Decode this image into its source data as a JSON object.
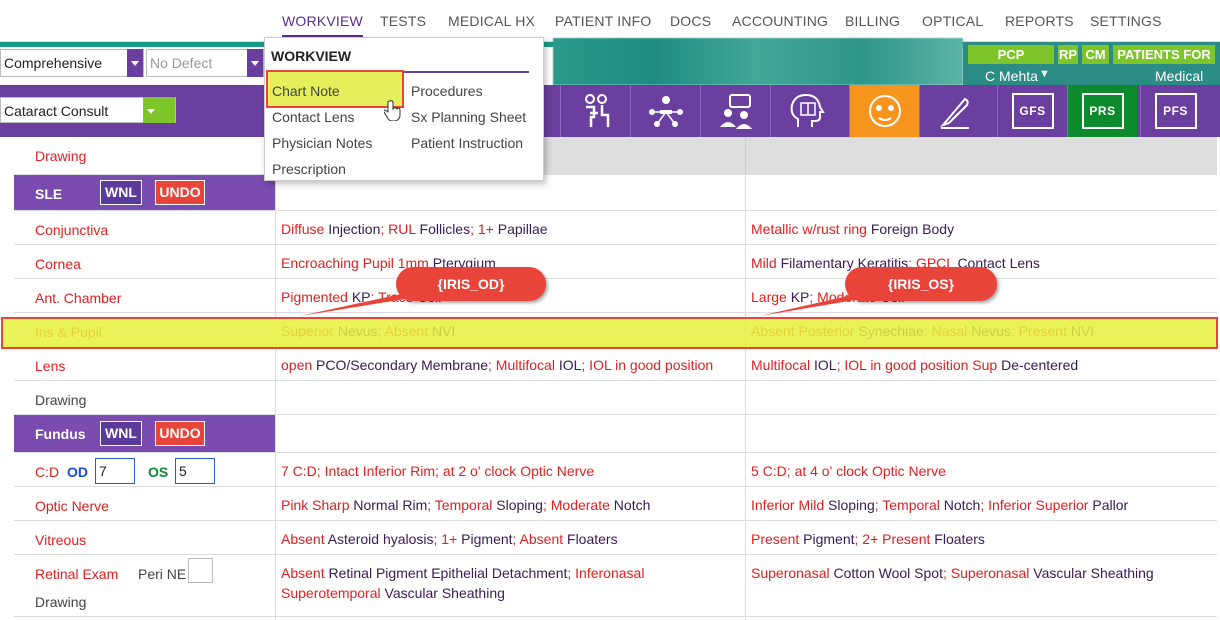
{
  "nav": {
    "items": [
      "WORKVIEW",
      "TESTS",
      "MEDICAL HX",
      "PATIENT INFO",
      "DOCS",
      "ACCOUNTING",
      "BILLING",
      "OPTICAL",
      "REPORTS",
      "SETTINGS"
    ],
    "active": "WORKVIEW"
  },
  "toolbar": {
    "exam_type": "Comprehensive",
    "defect_placeholder": "No Defect",
    "visit_template": "Cataract Consult"
  },
  "right_panel": {
    "pcp_label": "PCP",
    "rp_label": "RP",
    "cm_label": "CM",
    "patients_forms_label": "PATIENTS FOR",
    "provider_name": "C Mehta",
    "category": "Medical"
  },
  "icon_bar": {
    "tags": [
      "GFS",
      "PRS",
      "PFS"
    ],
    "icons": [
      "patient-exam-icon",
      "network-icon",
      "consult-icon",
      "head-book-icon",
      "face-icon",
      "scalpel-icon"
    ]
  },
  "workview_menu": {
    "title": "WORKVIEW",
    "col1": [
      "Chart Note",
      "Contact Lens",
      "Physician Notes",
      "Prescription"
    ],
    "col2": [
      "Procedures",
      "Sx Planning Sheet",
      "Patient Instruction"
    ]
  },
  "exam": {
    "drawing_label": "Drawing",
    "sle": {
      "title": "SLE",
      "wnl_label": "WNL",
      "undo_label": "UNDO",
      "rows": [
        {
          "label": "Conjunctiva",
          "od": [
            [
              "r",
              "Diffuse "
            ],
            [
              "k",
              "Injection"
            ],
            [
              "r",
              "; RUL "
            ],
            [
              "k",
              "Follicles"
            ],
            [
              "r",
              "; 1+ "
            ],
            [
              "k",
              "Papillae"
            ]
          ],
          "os": [
            [
              "r",
              "Metallic w/rust ring "
            ],
            [
              "k",
              "Foreign Body"
            ]
          ]
        },
        {
          "label": "Cornea",
          "od": [
            [
              "r",
              "Encroaching Pupil 1mm "
            ],
            [
              "k",
              "Pterygium"
            ]
          ],
          "os": [
            [
              "r",
              "Mild "
            ],
            [
              "k",
              "Filamentary Keratitis"
            ],
            [
              "r",
              "; GPCL "
            ],
            [
              "k",
              "Contact Lens"
            ]
          ]
        },
        {
          "label": "Ant. Chamber",
          "od": [
            [
              "r",
              "Pigmented "
            ],
            [
              "k",
              "KP"
            ],
            [
              "r",
              "; Trace "
            ],
            [
              "k",
              "Cell"
            ]
          ],
          "os": [
            [
              "r",
              "Large "
            ],
            [
              "k",
              "KP"
            ],
            [
              "r",
              "; Moderate "
            ],
            [
              "k",
              "Cell"
            ]
          ]
        },
        {
          "label": "Iris & Pupil",
          "od": [
            [
              "r",
              "Superior "
            ],
            [
              "k",
              "Nevus"
            ],
            [
              "r",
              "; Absent "
            ],
            [
              "k",
              "NVI"
            ]
          ],
          "os": [
            [
              "r",
              "Absent Posterior "
            ],
            [
              "k",
              "Synechiae"
            ],
            [
              "r",
              "; Nasal "
            ],
            [
              "k",
              "Nevus"
            ],
            [
              "r",
              "; Present "
            ],
            [
              "k",
              "NVI"
            ]
          ]
        },
        {
          "label": "Lens",
          "od": [
            [
              "r",
              "open "
            ],
            [
              "k",
              "PCO/Secondary Membrane"
            ],
            [
              "r",
              "; Multifocal "
            ],
            [
              "k",
              "IOL"
            ],
            [
              "r",
              "; IOL in good position"
            ]
          ],
          "os": [
            [
              "r",
              "Multifocal "
            ],
            [
              "k",
              "IOL"
            ],
            [
              "r",
              "; IOL in good position Sup "
            ],
            [
              "k",
              "De-centered"
            ]
          ]
        }
      ]
    },
    "fundus": {
      "title": "Fundus",
      "wnl_label": "WNL",
      "undo_label": "UNDO",
      "cd_label": "C:D",
      "od_label": "OD",
      "od_value": "7",
      "os_label": "OS",
      "os_value": "5",
      "cd_od": [
        [
          "r",
          "7 C:D; Intact Inferior Rim; at 2 o' clock Optic Nerve"
        ]
      ],
      "cd_os": [
        [
          "r",
          "5 C:D; at 4 o' clock Optic Nerve"
        ]
      ],
      "rows": [
        {
          "label": "Optic Nerve",
          "od": [
            [
              "r",
              "Pink Sharp "
            ],
            [
              "k",
              "Normal Rim"
            ],
            [
              "r",
              "; Temporal "
            ],
            [
              "k",
              "Sloping"
            ],
            [
              "r",
              "; Moderate "
            ],
            [
              "k",
              "Notch"
            ]
          ],
          "os": [
            [
              "r",
              "Inferior Mild "
            ],
            [
              "k",
              "Sloping"
            ],
            [
              "r",
              "; Temporal "
            ],
            [
              "k",
              "Notch"
            ],
            [
              "r",
              "; Inferior Superior "
            ],
            [
              "k",
              "Pallor"
            ]
          ]
        },
        {
          "label": "Vitreous",
          "od": [
            [
              "r",
              "Absent "
            ],
            [
              "k",
              "Asteroid hyalosis"
            ],
            [
              "r",
              "; 1+ "
            ],
            [
              "k",
              "Pigment"
            ],
            [
              "r",
              "; Absent "
            ],
            [
              "k",
              "Floaters"
            ]
          ],
          "os": [
            [
              "r",
              "Present "
            ],
            [
              "k",
              "Pigment"
            ],
            [
              "r",
              "; 2+ Present "
            ],
            [
              "k",
              "Floaters"
            ]
          ]
        },
        {
          "label": "Retinal Exam",
          "peri_label": "Peri NE",
          "od": [
            [
              "r",
              "Absent "
            ],
            [
              "k",
              "Retinal Pigment Epithelial Detachment"
            ],
            [
              "r",
              "; Inferonasal Superotemporal "
            ],
            [
              "k",
              "Vascular Sheathing"
            ]
          ],
          "os": [
            [
              "r",
              "Superonasal "
            ],
            [
              "k",
              "Cotton Wool Spot"
            ],
            [
              "r",
              "; Superonasal "
            ],
            [
              "k",
              "Vascular Sheathing"
            ]
          ]
        }
      ]
    }
  },
  "callouts": {
    "od": "{IRIS_OD}",
    "os": "{IRIS_OS}"
  }
}
